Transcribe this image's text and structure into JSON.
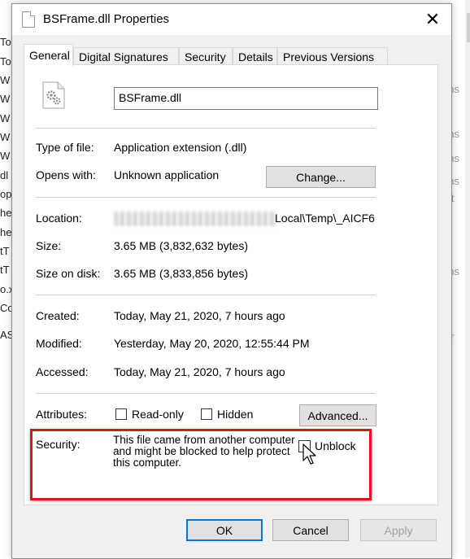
{
  "window": {
    "title": "BSFrame.dll Properties",
    "close_glyph": "✕"
  },
  "tabs": [
    {
      "label": "General",
      "active": true
    },
    {
      "label": "Digital Signatures",
      "active": false
    },
    {
      "label": "Security",
      "active": false
    },
    {
      "label": "Details",
      "active": false
    },
    {
      "label": "Previous Versions",
      "active": false
    }
  ],
  "general": {
    "file_name": "BSFrame.dll",
    "type_label": "Type of file:",
    "type_value": "Application extension (.dll)",
    "opens_label": "Opens with:",
    "opens_value": "Unknown application",
    "change_button": "Change...",
    "location_label": "Location:",
    "location_value": "Local\\Temp\\_AICF6",
    "size_label": "Size:",
    "size_value": "3.65 MB (3,832,632 bytes)",
    "size_on_disk_label": "Size on disk:",
    "size_on_disk_value": "3.65 MB (3,833,856 bytes)",
    "created_label": "Created:",
    "created_value": "Today, May 21, 2020, 7 hours ago",
    "modified_label": "Modified:",
    "modified_value": "Yesterday, May 20, 2020, 12:55:44 PM",
    "accessed_label": "Accessed:",
    "accessed_value": "Today, May 21, 2020, 7 hours ago",
    "attributes_label": "Attributes:",
    "readonly_label": "Read-only",
    "hidden_label": "Hidden",
    "advanced_button": "Advanced...",
    "security_label": "Security:",
    "security_text": "This file came from another computer and might be blocked to help protect this computer.",
    "unblock_label": "Unblock"
  },
  "buttons": {
    "ok": "OK",
    "cancel": "Cancel",
    "apply": "Apply"
  },
  "background": {
    "left_fragments": [
      "To",
      "To",
      "W",
      "W",
      "W",
      "W",
      "W",
      "dl",
      "op",
      "he",
      "he",
      "tT",
      "tT",
      "o.x",
      "Co",
      "AS"
    ],
    "right_fragments": [
      "ens",
      "ens",
      "ens",
      "ett",
      "ens",
      "ens",
      "ler"
    ]
  },
  "colors": {
    "highlight_border": "#e0161c",
    "primary_button_border": "#0078d7"
  }
}
